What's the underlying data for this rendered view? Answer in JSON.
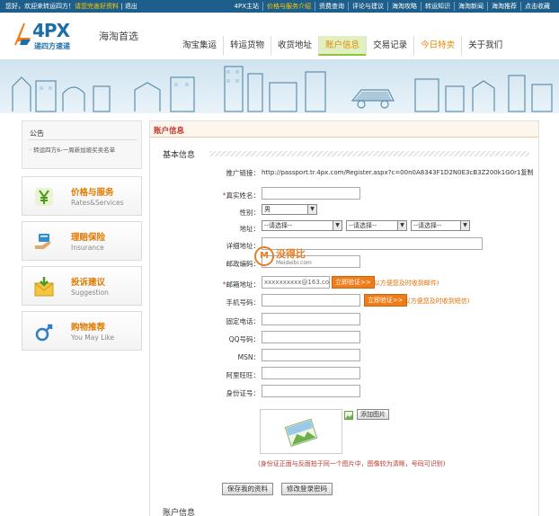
{
  "topbar": {
    "greeting": "您好，欢迎来转运四方！",
    "complete_profile": "请您完善好资料",
    "logout": "退出",
    "links": [
      "4PX主站",
      "价格与服务介绍",
      "资费查询",
      "评论与建议",
      "海淘攻略",
      "转运知识",
      "海淘新闻",
      "海淘推荐",
      "点击收藏"
    ]
  },
  "header": {
    "brand": "4PX",
    "brand_sub": "递四方速递",
    "slogan": "海淘首选",
    "nav": [
      {
        "label": "淘宝集运",
        "state": "normal"
      },
      {
        "label": "转运货物",
        "state": "normal"
      },
      {
        "label": "收货地址",
        "state": "normal"
      },
      {
        "label": "账户信息",
        "state": "active"
      },
      {
        "label": "交易记录",
        "state": "normal"
      },
      {
        "label": "今日特卖",
        "state": "special"
      },
      {
        "label": "关于我们",
        "state": "normal"
      }
    ]
  },
  "sidebar": {
    "notice_title": "公告",
    "notice_text": "· 转运四方6-一周新加坡买卖名单",
    "items": [
      {
        "cn": "价格与服务",
        "en": "Rates&Services",
        "icon": "yen-icon"
      },
      {
        "cn": "理赔保险",
        "en": "Insurance",
        "icon": "hand-shield-icon"
      },
      {
        "cn": "投诉建议",
        "en": "Suggestion",
        "icon": "mail-icon"
      },
      {
        "cn": "购物推荐",
        "en": "You May Like",
        "icon": "shopping-icon"
      }
    ]
  },
  "panel": {
    "title": "账户信息",
    "section_basic": "基本信息",
    "section_next": "账户信息",
    "referral_label": "推广链接：",
    "referral_url": "http://passport.tr.4px.com/Register.aspx?c=00n0A8343F1D2N0E3cB3Z200k1G0r1复制"
  },
  "form": {
    "real_name": {
      "label": "真实姓名：",
      "required": true,
      "value": ""
    },
    "gender": {
      "label": "性别：",
      "value": "男"
    },
    "address": {
      "label": "地址：",
      "selects": [
        "--请选择--",
        "--请选择--",
        "--请选择--"
      ]
    },
    "detail_address": {
      "label": "详细地址：",
      "value": ""
    },
    "postcode": {
      "label": "邮政编码：",
      "value": ""
    },
    "email": {
      "label": "邮箱地址：",
      "required": true,
      "value": "xxxxxxxxxx@163.com",
      "button": "立即验证>>",
      "hint": "(以方便您及时收到邮件)"
    },
    "mobile": {
      "label": "手机号码：",
      "value": "",
      "button": "立即验证>>",
      "hint": "(以方便您及时收到短信)"
    },
    "phone": {
      "label": "固定电话：",
      "value": ""
    },
    "qq": {
      "label": "QQ号码：",
      "value": ""
    },
    "msn": {
      "label": "MSN：",
      "value": ""
    },
    "wangwang": {
      "label": "阿里旺旺：",
      "value": ""
    },
    "id_card": {
      "label": "身份证号：",
      "value": ""
    },
    "upload_button": "添加图片",
    "photo_note": "(身份证正面与反面拍于同一个图片中，图像较为清晰，号码可识别)",
    "save_button": "保存我的资料",
    "password_button": "修改登录密码"
  },
  "watermark": {
    "text": "没得比",
    "url": "Meideibi.com",
    "mark": "M"
  },
  "colors": {
    "topbar": "#1d5f8a",
    "accent": "#e07a00",
    "active_nav": "#e2f0c0",
    "required": "#c0392b"
  }
}
